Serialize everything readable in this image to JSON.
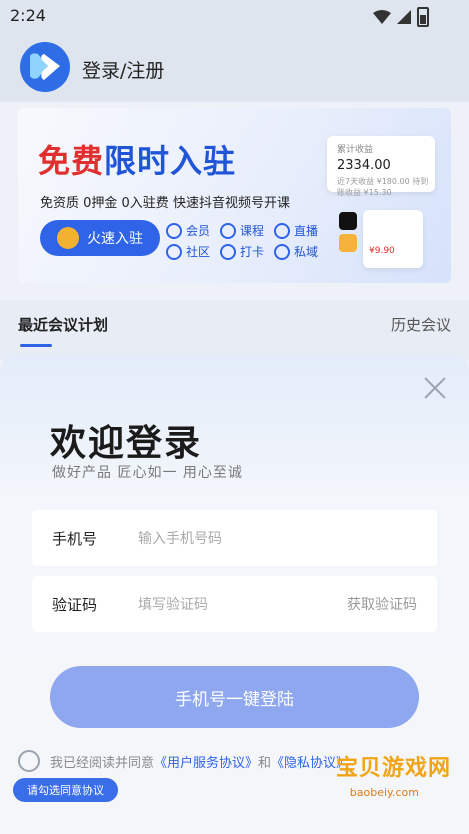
{
  "status": {
    "time": "2:24"
  },
  "header": {
    "title": "登录/注册"
  },
  "banner": {
    "title_red": "免费",
    "title_blue": "限时入驻",
    "subtitle": "免资质  0押金  0入驻费  快速抖音视频号开课",
    "button": "火速入驻",
    "features": [
      "会员",
      "课程",
      "直播",
      "社区",
      "打卡",
      "私域"
    ],
    "card": {
      "label": "累计收益",
      "amount": "2334.00",
      "foot": "近7天收益 ¥180.00   待到账收益 ¥15.30"
    },
    "card2_price": "¥9.90"
  },
  "tabs": {
    "active": "最近会议计划",
    "history": "历史会议"
  },
  "login": {
    "welcome": "欢迎登录",
    "tagline": "做好产品  匠心如一  用心至诚",
    "phone_label": "手机号",
    "phone_placeholder": "输入手机号码",
    "code_label": "验证码",
    "code_placeholder": "填写验证码",
    "get_code": "获取验证码",
    "submit": "手机号一键登陆",
    "agree_prefix": "我已经阅读并同意",
    "agree_link1": "《用户服务协议》",
    "agree_and": "和",
    "agree_link2": "《隐私协议》",
    "tooltip": "请勾选同意协议"
  },
  "watermark": {
    "main": "宝贝游戏网",
    "sub": "baobeiy.com"
  },
  "colors": {
    "accent": "#2f63e8",
    "button": "#8ea7ef",
    "brand_red": "#e02f2f"
  }
}
